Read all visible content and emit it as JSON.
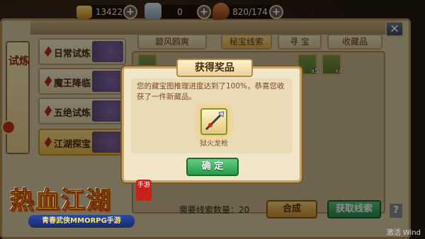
{
  "resources": {
    "gold": "13422",
    "gems": "0",
    "stamina": "820/174"
  },
  "side_banner": "试炼",
  "nav": [
    {
      "label": "日常试炼"
    },
    {
      "label": "魔王降临"
    },
    {
      "label": "五绝试炼"
    },
    {
      "label": "江湖探宝",
      "active": true
    }
  ],
  "tabs": [
    {
      "label": "碧风鸥爽"
    },
    {
      "label": "秘宝线索",
      "active": true
    },
    {
      "label": "寻 宝"
    },
    {
      "label": "收藏品"
    }
  ],
  "items": [
    {
      "count": ""
    },
    {
      "count": "x5"
    },
    {
      "count": "x4"
    }
  ],
  "panel": {
    "clue_count": "需要线索数量：20",
    "compose_button": "合成",
    "get_clue_button": "获取线索",
    "help_button": "?"
  },
  "dialog": {
    "title": "获得奖品",
    "message": "您的藏宝图推理进度达到了100%，恭喜您收获了一件新藏品。",
    "reward_name": "狱火龙枪",
    "ok_button": "确 定"
  },
  "logo": {
    "title": "热血江湖",
    "badge": "手游",
    "subtitle": "青春武侠MMORPG手游"
  },
  "close_icon": "close-icon",
  "watermark": "激活 Wind"
}
